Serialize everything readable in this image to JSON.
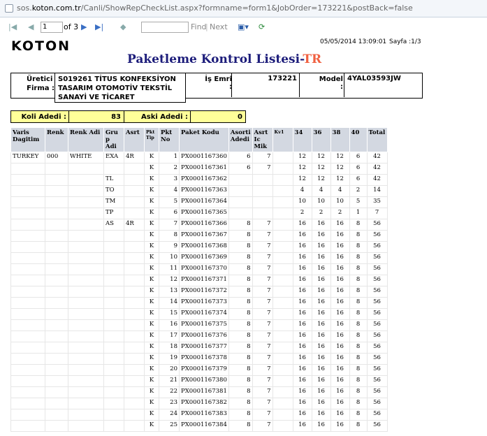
{
  "browser": {
    "url_prefix": "sos.",
    "url_domain": "koton.com.tr",
    "url_path": "/Canli/ShowRepCheckList.aspx?formname=form1&JobOrder=173221&postBack=false"
  },
  "toolbar": {
    "page": "1",
    "of": "of 3",
    "find": "Find",
    "next": "Next"
  },
  "report": {
    "logo": "KOTON",
    "datetime": "05/05/2014 13:09:01",
    "page_label": "Sayfa :1/3",
    "title_main": "Paketleme Kontrol Listesi-",
    "title_tr": "TR",
    "uretici_label": "Üretici",
    "firma_label": "Firma :",
    "firma_value": "S019261 TİTUS KONFEKSİYON TASARIM OTOMOTİV TEKSTİL SANAYİ VE TİCARET",
    "is_emri_label": "İş Emri :",
    "is_emri_value": "173221",
    "model_label": "Model :",
    "model_value": "4YAL03593JW",
    "koli_label": "Koli Adedi :",
    "koli_value": "83",
    "aski_label": "Aski Adedi :",
    "aski_value": "0"
  },
  "columns": [
    "Varis Dagitim",
    "Renk",
    "Renk Adi",
    "Gru p Adi",
    "Asrt",
    "Pkt Tip",
    "Pkt No",
    "Paket Kodu",
    "Asorti Adedi",
    "Asrt Ic Mik",
    "Kv1",
    "34",
    "36",
    "38",
    "40",
    "Total"
  ],
  "rows": [
    [
      "TURKEY",
      "000",
      "WHITE",
      "EXA",
      "4R",
      "K",
      "1",
      "PX0001167360",
      "6",
      "7",
      "",
      "12",
      "12",
      "12",
      "6",
      "42"
    ],
    [
      "",
      "",
      "",
      "",
      "",
      "K",
      "2",
      "PX0001167361",
      "6",
      "7",
      "",
      "12",
      "12",
      "12",
      "6",
      "42"
    ],
    [
      "",
      "",
      "",
      "TL",
      "",
      "K",
      "3",
      "PX0001167362",
      "",
      "",
      "",
      "12",
      "12",
      "12",
      "6",
      "42"
    ],
    [
      "",
      "",
      "",
      "TO",
      "",
      "K",
      "4",
      "PX0001167363",
      "",
      "",
      "",
      "4",
      "4",
      "4",
      "2",
      "14"
    ],
    [
      "",
      "",
      "",
      "TM",
      "",
      "K",
      "5",
      "PX0001167364",
      "",
      "",
      "",
      "10",
      "10",
      "10",
      "5",
      "35"
    ],
    [
      "",
      "",
      "",
      "TP",
      "",
      "K",
      "6",
      "PX0001167365",
      "",
      "",
      "",
      "2",
      "2",
      "2",
      "1",
      "7"
    ],
    [
      "",
      "",
      "",
      "AS",
      "4R",
      "K",
      "7",
      "PX0001167366",
      "8",
      "7",
      "",
      "16",
      "16",
      "16",
      "8",
      "56"
    ],
    [
      "",
      "",
      "",
      "",
      "",
      "K",
      "8",
      "PX0001167367",
      "8",
      "7",
      "",
      "16",
      "16",
      "16",
      "8",
      "56"
    ],
    [
      "",
      "",
      "",
      "",
      "",
      "K",
      "9",
      "PX0001167368",
      "8",
      "7",
      "",
      "16",
      "16",
      "16",
      "8",
      "56"
    ],
    [
      "",
      "",
      "",
      "",
      "",
      "K",
      "10",
      "PX0001167369",
      "8",
      "7",
      "",
      "16",
      "16",
      "16",
      "8",
      "56"
    ],
    [
      "",
      "",
      "",
      "",
      "",
      "K",
      "11",
      "PX0001167370",
      "8",
      "7",
      "",
      "16",
      "16",
      "16",
      "8",
      "56"
    ],
    [
      "",
      "",
      "",
      "",
      "",
      "K",
      "12",
      "PX0001167371",
      "8",
      "7",
      "",
      "16",
      "16",
      "16",
      "8",
      "56"
    ],
    [
      "",
      "",
      "",
      "",
      "",
      "K",
      "13",
      "PX0001167372",
      "8",
      "7",
      "",
      "16",
      "16",
      "16",
      "8",
      "56"
    ],
    [
      "",
      "",
      "",
      "",
      "",
      "K",
      "14",
      "PX0001167373",
      "8",
      "7",
      "",
      "16",
      "16",
      "16",
      "8",
      "56"
    ],
    [
      "",
      "",
      "",
      "",
      "",
      "K",
      "15",
      "PX0001167374",
      "8",
      "7",
      "",
      "16",
      "16",
      "16",
      "8",
      "56"
    ],
    [
      "",
      "",
      "",
      "",
      "",
      "K",
      "16",
      "PX0001167375",
      "8",
      "7",
      "",
      "16",
      "16",
      "16",
      "8",
      "56"
    ],
    [
      "",
      "",
      "",
      "",
      "",
      "K",
      "17",
      "PX0001167376",
      "8",
      "7",
      "",
      "16",
      "16",
      "16",
      "8",
      "56"
    ],
    [
      "",
      "",
      "",
      "",
      "",
      "K",
      "18",
      "PX0001167377",
      "8",
      "7",
      "",
      "16",
      "16",
      "16",
      "8",
      "56"
    ],
    [
      "",
      "",
      "",
      "",
      "",
      "K",
      "19",
      "PX0001167378",
      "8",
      "7",
      "",
      "16",
      "16",
      "16",
      "8",
      "56"
    ],
    [
      "",
      "",
      "",
      "",
      "",
      "K",
      "20",
      "PX0001167379",
      "8",
      "7",
      "",
      "16",
      "16",
      "16",
      "8",
      "56"
    ],
    [
      "",
      "",
      "",
      "",
      "",
      "K",
      "21",
      "PX0001167380",
      "8",
      "7",
      "",
      "16",
      "16",
      "16",
      "8",
      "56"
    ],
    [
      "",
      "",
      "",
      "",
      "",
      "K",
      "22",
      "PX0001167381",
      "8",
      "7",
      "",
      "16",
      "16",
      "16",
      "8",
      "56"
    ],
    [
      "",
      "",
      "",
      "",
      "",
      "K",
      "23",
      "PX0001167382",
      "8",
      "7",
      "",
      "16",
      "16",
      "16",
      "8",
      "56"
    ],
    [
      "",
      "",
      "",
      "",
      "",
      "K",
      "24",
      "PX0001167383",
      "8",
      "7",
      "",
      "16",
      "16",
      "16",
      "8",
      "56"
    ],
    [
      "",
      "",
      "",
      "",
      "",
      "K",
      "25",
      "PX0001167384",
      "8",
      "7",
      "",
      "16",
      "16",
      "16",
      "8",
      "56"
    ]
  ]
}
